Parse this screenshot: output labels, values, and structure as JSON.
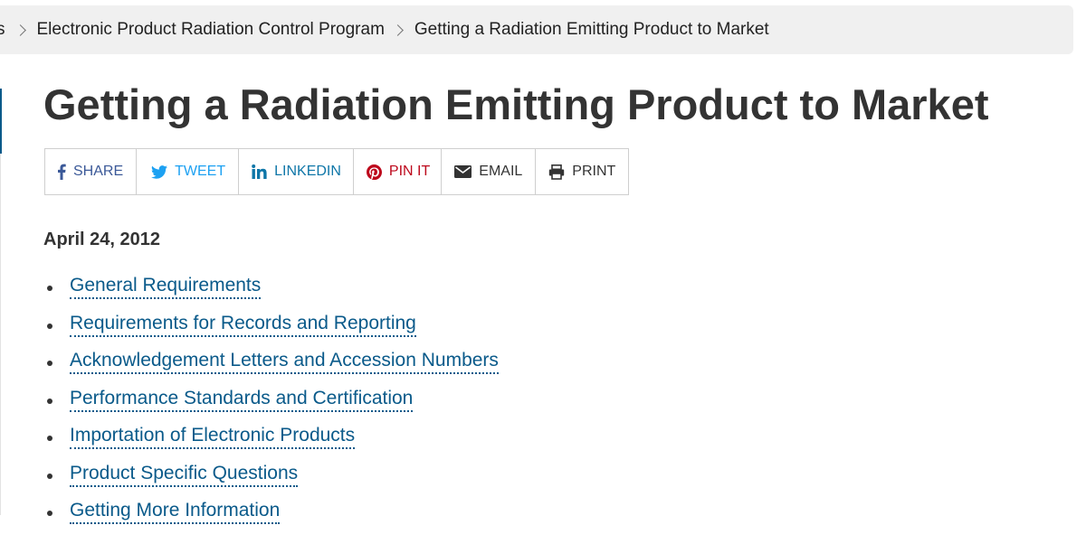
{
  "breadcrumb": {
    "partial": "s",
    "items": [
      "Electronic Product Radiation Control Program",
      "Getting a Radiation Emitting Product to Market"
    ]
  },
  "page": {
    "title": "Getting a Radiation Emitting Product to Market",
    "date": "April 24, 2012"
  },
  "share": {
    "facebook": "SHARE",
    "twitter": "TWEET",
    "linkedin": "LINKEDIN",
    "pinterest": "PIN IT",
    "email": "EMAIL",
    "print": "PRINT"
  },
  "links": [
    "General Requirements",
    "Requirements for Records and Reporting",
    "Acknowledgement Letters and Accession Numbers",
    "Performance Standards and Certification",
    "Importation of Electronic Products",
    "Product Specific Questions",
    "Getting More Information"
  ],
  "colors": {
    "link": "#0a5a8a",
    "facebook": "#3b5998",
    "twitter": "#1da1f2",
    "linkedin": "#0e76a8",
    "pinterest": "#bd081c",
    "breadcrumb_bg": "#f0f0f0"
  }
}
